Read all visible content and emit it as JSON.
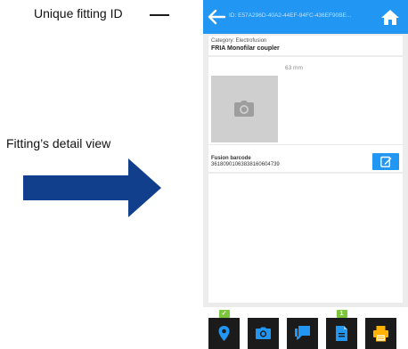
{
  "annotations": {
    "top_label": "Unique fitting ID",
    "mid_label": "Fitting’s detail view"
  },
  "colors": {
    "primary": "#2196f3",
    "accent_orange": "#ffb300",
    "badge_green": "#7cc63b",
    "arrow_navy": "#123f8c"
  },
  "app": {
    "fitting_id": "ID: E57A296D-40A2-44EF-94FC-436EF90BE..."
  },
  "fitting": {
    "category": "Category: Electrofusion",
    "name": "FRIA Monofilar coupler",
    "dimension": "63 mm",
    "barcode_label": "Fusion barcode",
    "barcode_value": "36180901063838160604739"
  },
  "bottom_bar": {
    "items": [
      {
        "icon": "location-pin-icon",
        "badge": "✓"
      },
      {
        "icon": "camera-icon",
        "badge": ""
      },
      {
        "icon": "chat-icon",
        "badge": ""
      },
      {
        "icon": "document-icon",
        "badge": "1"
      },
      {
        "icon": "printer-icon",
        "badge": ""
      }
    ]
  }
}
